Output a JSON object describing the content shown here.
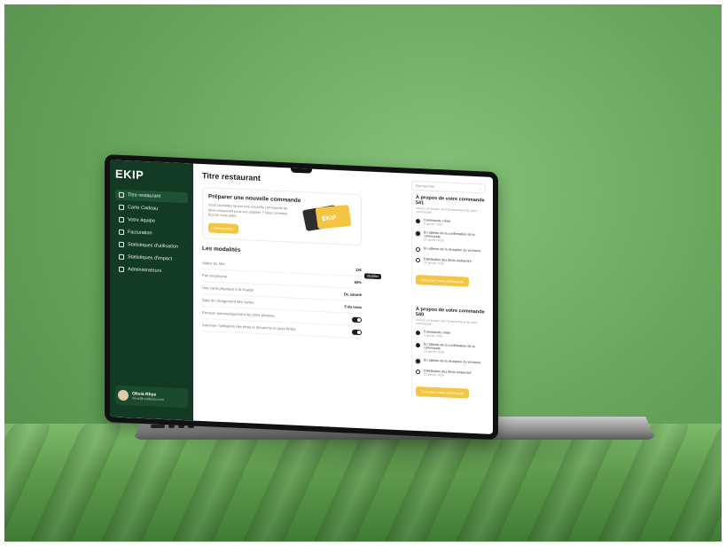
{
  "app": {
    "logo": "EKIP",
    "page_title": "Titre restaurant"
  },
  "sidebar": {
    "items": [
      {
        "label": "Titre restaurant",
        "icon": "receipt-icon",
        "active": true
      },
      {
        "label": "Carte Cadeau",
        "icon": "gift-card-icon"
      },
      {
        "label": "Votre équipe",
        "icon": "team-icon"
      },
      {
        "label": "Facturation",
        "icon": "invoice-icon"
      },
      {
        "label": "Statistiques d'utilisation",
        "icon": "chart-icon"
      },
      {
        "label": "Statistiques d'impact",
        "icon": "impact-icon"
      },
      {
        "label": "Administrateurs",
        "icon": "admin-icon"
      }
    ],
    "user": {
      "name": "Olivia Rhye",
      "email": "olivia@untitledui.com"
    }
  },
  "order_card": {
    "title": "Préparer une nouvelle commande",
    "desc": "Vous souhaitez lancer une nouvelle commande de titres-restaurant pour vos salariés ? Nous sommes là pour vous aider.",
    "button": "Commander",
    "card_logo": "EKIP"
  },
  "modalites": {
    "title": "Les modalités",
    "rows": [
      {
        "label": "Valeur du titre",
        "value": "12€"
      },
      {
        "label": "Part employeur",
        "value": "60%"
      },
      {
        "label": "Une carte physique à la charge",
        "value": "Du salarié"
      },
      {
        "label": "Date de chargement des cartes",
        "value": "5 du mois"
      },
      {
        "label": "Envoyer automatiquement les titres périmés",
        "value": ""
      },
      {
        "label": "Autoriser l'utilisation des titres le dimanche et jours fériés",
        "value": ""
      }
    ],
    "tooltip": "Modifier"
  },
  "search": {
    "placeholder": "Rechercher..."
  },
  "orders": [
    {
      "title": "À propos de votre commande 541",
      "subtitle": "Suivez en temps réel l'avancement de votre commande",
      "steps": [
        {
          "label": "Commande créée",
          "date": "8 janvier 2026",
          "state": "done"
        },
        {
          "label": "En attente de la confirmation de la commande",
          "date": "10 janvier 2026",
          "state": "cur"
        },
        {
          "label": "En attente de la réception du virement",
          "date": "",
          "state": "todo"
        },
        {
          "label": "Distribution des titres restaurant",
          "date": "20 janvier 2026",
          "state": "todo"
        }
      ],
      "button": "Consulter votre commande"
    },
    {
      "title": "À propos de votre commande 540",
      "subtitle": "Suivez en temps réel l'avancement de votre commande",
      "steps": [
        {
          "label": "Commande créée",
          "date": "8 janvier 2026",
          "state": "done"
        },
        {
          "label": "En attente de la confirmation de la commande",
          "date": "10 janvier 2026",
          "state": "done"
        },
        {
          "label": "En attente de la réception du virement",
          "date": "",
          "state": "cur"
        },
        {
          "label": "Distribution des titres restaurant",
          "date": "20 janvier 2026",
          "state": "todo"
        }
      ],
      "button": "Consulter votre commande"
    }
  ],
  "colors": {
    "sidebar": "#123a24",
    "accent": "#f4c543",
    "background": "#6da862"
  }
}
